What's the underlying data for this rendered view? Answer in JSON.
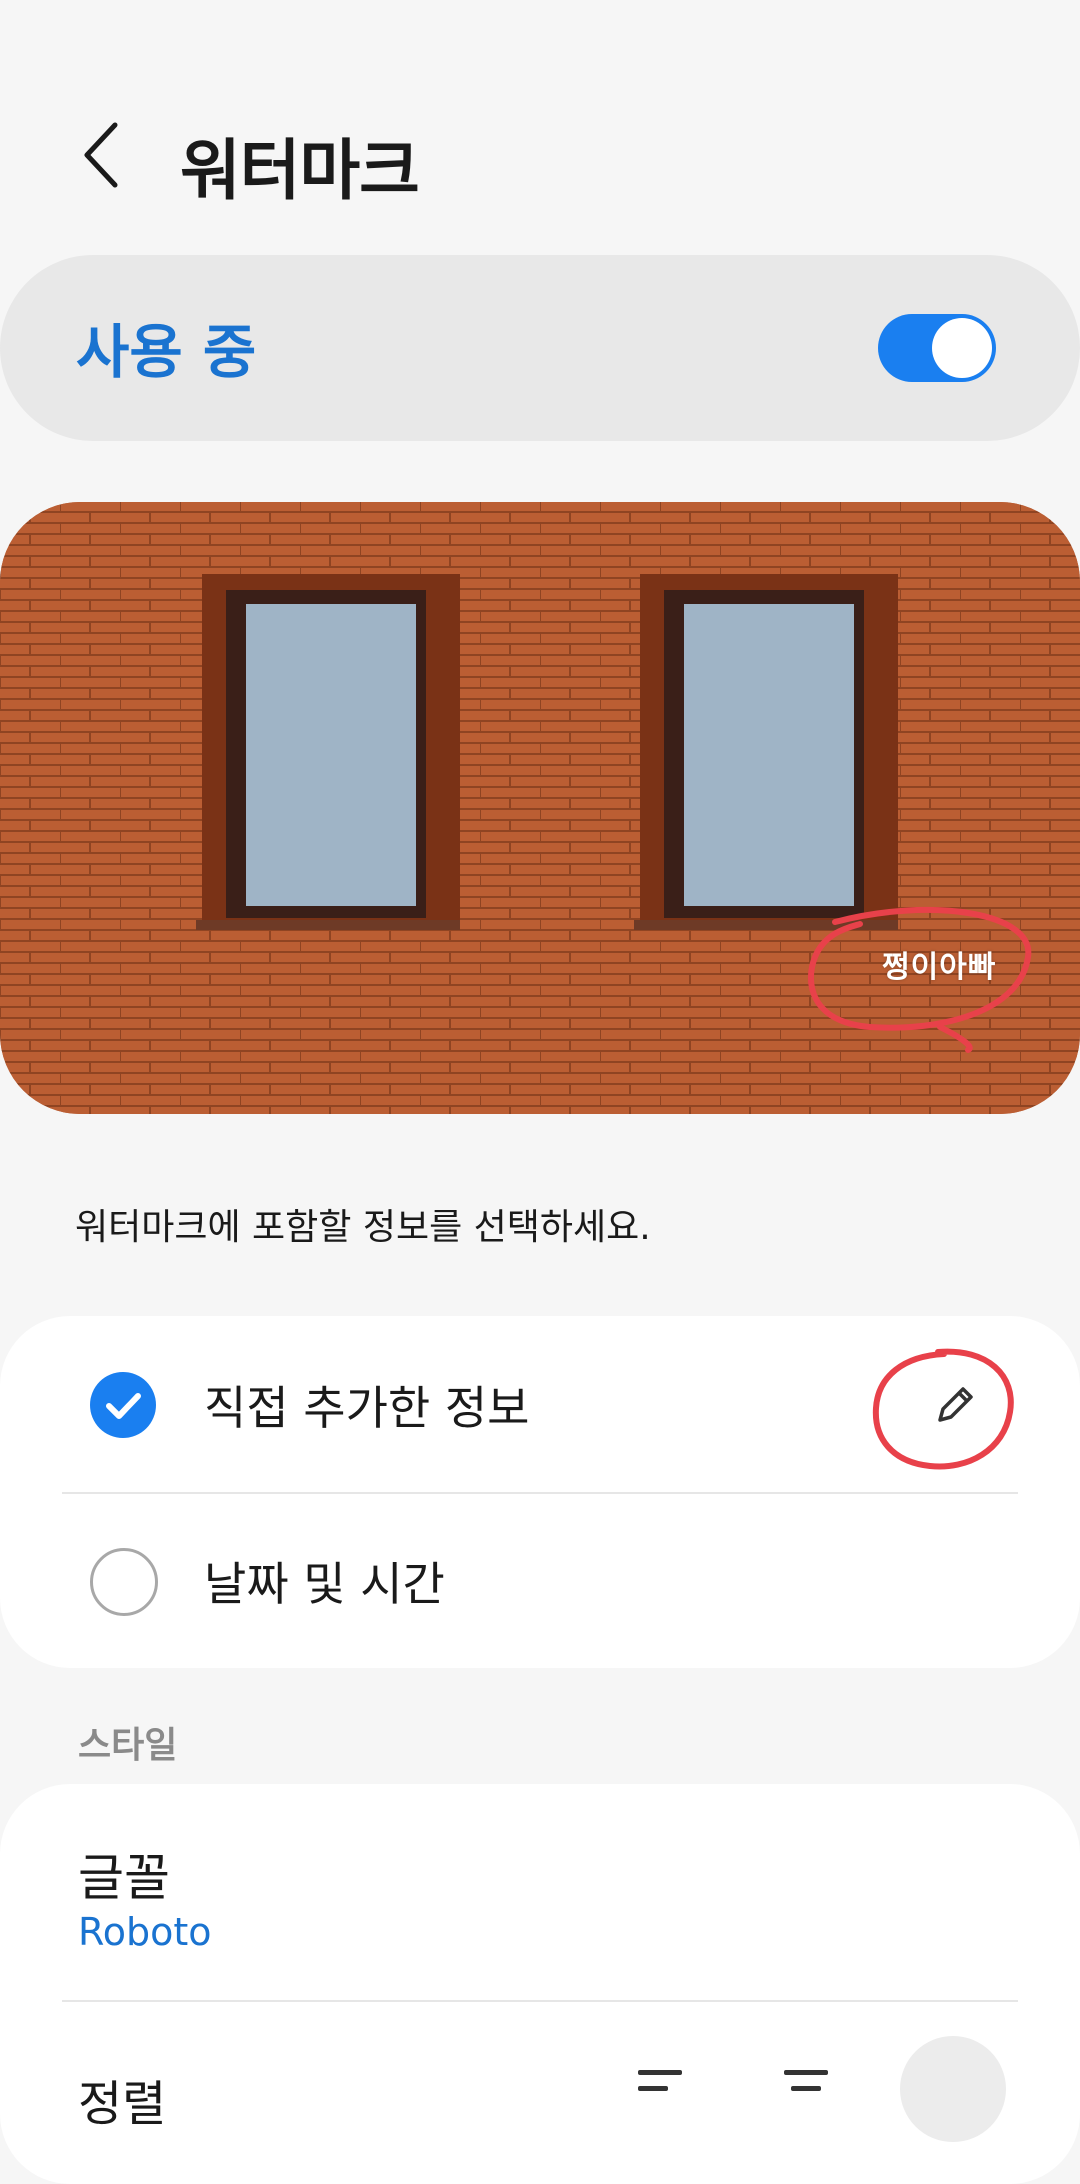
{
  "header": {
    "title": "워터마크",
    "back_icon": "chevron-left-icon"
  },
  "toggle": {
    "label": "사용 중",
    "on": true,
    "accent": "#1a7ff0"
  },
  "preview": {
    "watermark_text": "쩡이아빠",
    "annotation_color": "#e8414a"
  },
  "description": "워터마크에 포함할 정보를 선택하세요.",
  "options": [
    {
      "label": "직접 추가한 정보",
      "checked": true,
      "edit_icon": "pencil-icon"
    },
    {
      "label": "날짜 및 시간",
      "checked": false
    }
  ],
  "style_section": {
    "title": "스타일",
    "font_label": "글꼴",
    "font_value": "Roboto",
    "align_label": "정렬",
    "align_options": [
      "align-left-icon",
      "align-center-icon",
      "align-right-icon"
    ],
    "align_selected": 2
  }
}
